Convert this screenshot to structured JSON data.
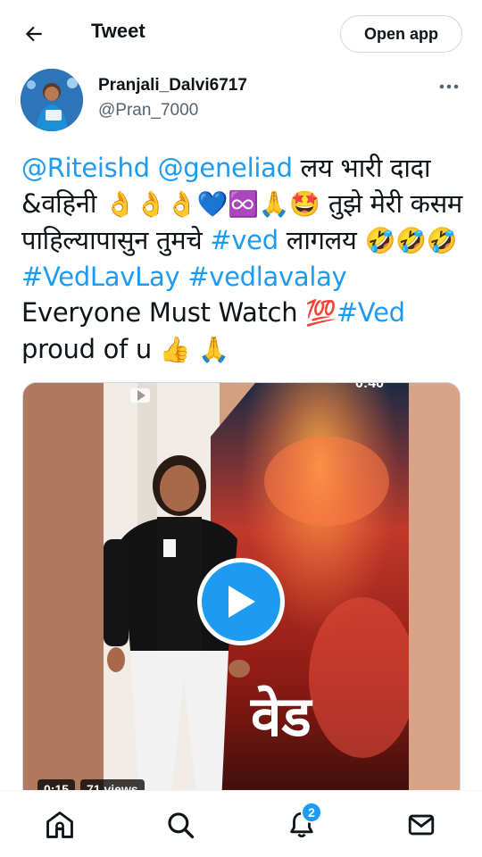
{
  "header": {
    "title": "Tweet",
    "open_app_label": "Open app"
  },
  "author": {
    "name": "Pranjali_Dalvi6717",
    "handle": "@Pran_7000"
  },
  "tweet": {
    "segments": [
      {
        "text": "@Riteishd",
        "type": "mention"
      },
      {
        "text": " ",
        "type": "text"
      },
      {
        "text": "@geneliad",
        "type": "mention"
      },
      {
        "text": " लय भारी दादा &वहिनी ",
        "type": "text"
      },
      {
        "text": "👌👌👌💙♾️🙏🤩",
        "type": "emoji"
      },
      {
        "text": " तुझे मेरी कसम पाहिल्यापासुन तुमचे ",
        "type": "text"
      },
      {
        "text": "#ved",
        "type": "hashtag"
      },
      {
        "text": " लागलय ",
        "type": "text"
      },
      {
        "text": "🤣🤣🤣",
        "type": "emoji"
      },
      {
        "text": "#VedLavLay",
        "type": "hashtag"
      },
      {
        "text": " ",
        "type": "text"
      },
      {
        "text": "#vedlavalay",
        "type": "hashtag"
      },
      {
        "text": " Everyone Must Watch ",
        "type": "text"
      },
      {
        "text": "💯",
        "type": "emoji"
      },
      {
        "text": "#Ved",
        "type": "hashtag"
      },
      {
        "text": " proud of u ",
        "type": "text"
      },
      {
        "text": "👍 🙏",
        "type": "emoji"
      }
    ]
  },
  "media": {
    "duration": "0:15",
    "views": "71 views",
    "top_timestamp": "0:40",
    "poster_title": "वेड"
  },
  "nav": {
    "notification_count": "2"
  },
  "colors": {
    "accent": "#1d9bf0",
    "text": "#0f1419",
    "secondary": "#536471"
  }
}
